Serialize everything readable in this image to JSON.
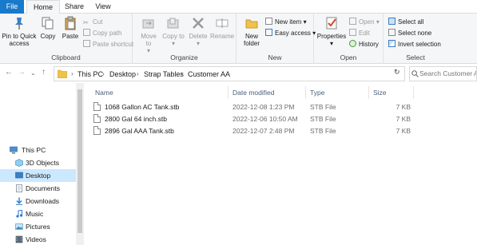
{
  "tabs": {
    "file": "File",
    "home": "Home",
    "share": "Share",
    "view": "View"
  },
  "ribbon": {
    "clipboard": {
      "label": "Clipboard",
      "pin": "Pin to Quick access",
      "copy": "Copy",
      "paste": "Paste",
      "cut": "Cut",
      "copy_path": "Copy path",
      "paste_shortcut": "Paste shortcut"
    },
    "organize": {
      "label": "Organize",
      "move_to": "Move to",
      "copy_to": "Copy to",
      "delete": "Delete",
      "rename": "Rename"
    },
    "new": {
      "label": "New",
      "new_folder": "New folder",
      "new_item": "New item",
      "easy_access": "Easy access"
    },
    "open": {
      "label": "Open",
      "properties": "Properties",
      "open": "Open",
      "edit": "Edit",
      "history": "History"
    },
    "select": {
      "label": "Select",
      "select_all": "Select all",
      "select_none": "Select none",
      "invert_selection": "Invert selection"
    }
  },
  "address": {
    "crumbs": [
      "This PC",
      "Desktop",
      "Strap Tables",
      "Customer AA"
    ],
    "search_placeholder": "Search Customer AA"
  },
  "nav": {
    "this_pc": "This PC",
    "items": [
      "3D Objects",
      "Desktop",
      "Documents",
      "Downloads",
      "Music",
      "Pictures",
      "Videos"
    ]
  },
  "columns": {
    "name": "Name",
    "date": "Date modified",
    "type": "Type",
    "size": "Size"
  },
  "files": [
    {
      "name": "1068 Gallon AC Tank.stb",
      "date": "2022-12-08 1:23 PM",
      "type": "STB File",
      "size": "7 KB"
    },
    {
      "name": "2800 Gal 64 inch.stb",
      "date": "2022-12-06 10:50 AM",
      "type": "STB File",
      "size": "7 KB"
    },
    {
      "name": "2896 Gal AAA Tank.stb",
      "date": "2022-12-07 2:48 PM",
      "type": "STB File",
      "size": "7 KB"
    }
  ],
  "colors": {
    "accent": "#1979ca",
    "selection": "#cce8ff",
    "folder": "#f0c14b"
  }
}
